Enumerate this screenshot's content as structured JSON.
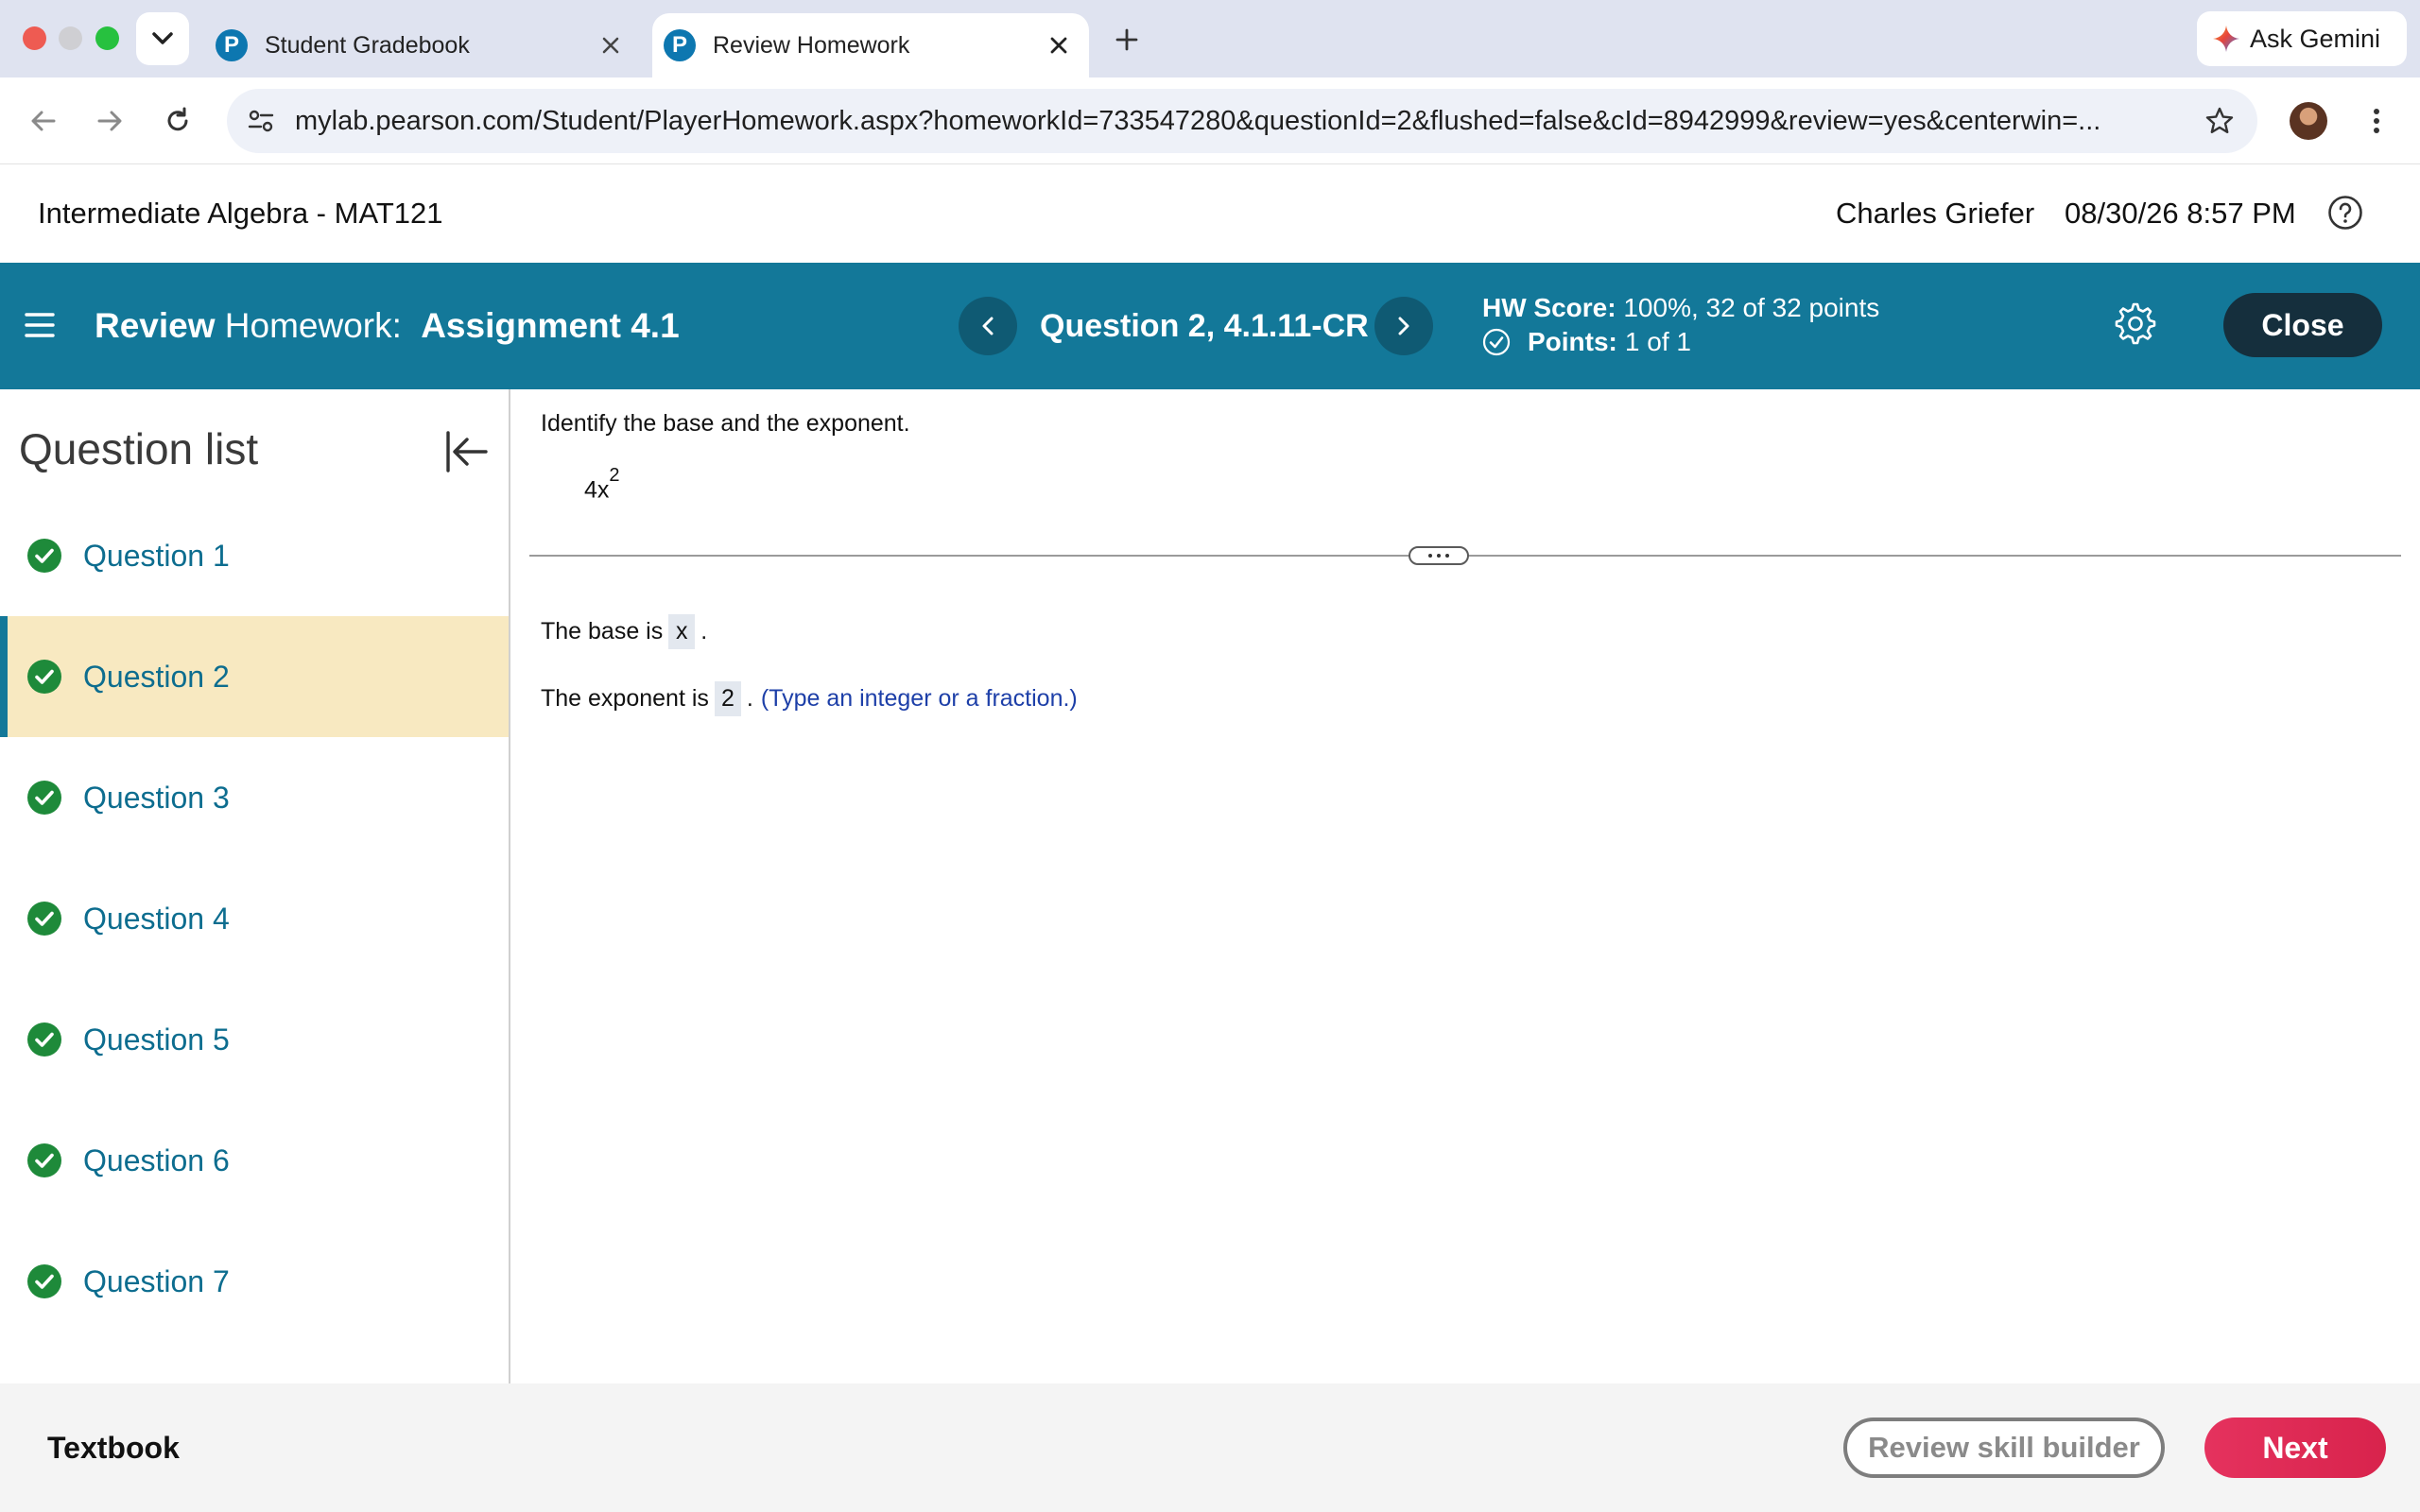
{
  "browser": {
    "tabs": [
      {
        "title": "Student Gradebook",
        "favicon": "P",
        "active": false
      },
      {
        "title": "Review Homework",
        "favicon": "P",
        "active": true
      }
    ],
    "gemini_label": "Ask Gemini",
    "url": "mylab.pearson.com/Student/PlayerHomework.aspx?homeworkId=733547280&questionId=2&flushed=false&cId=8942999&review=yes&centerwin=..."
  },
  "course": {
    "title": "Intermediate Algebra - MAT121",
    "user": "Charles Griefer",
    "datetime": "08/30/26 8:57 PM"
  },
  "assignment": {
    "mode_bold": "Review",
    "mode_rest": "Homework:",
    "name": "Assignment 4.1",
    "question_label": "Question 2, 4.1.11-CR",
    "hw_score_label": "HW Score:",
    "hw_score_value": "100%, 32 of 32 points",
    "points_label": "Points:",
    "points_value": "1 of 1",
    "close_label": "Close",
    "accent_color": "#137899"
  },
  "sidebar": {
    "title": "Question list",
    "items": [
      {
        "label": "Question 1",
        "status": "correct"
      },
      {
        "label": "Question 2",
        "status": "correct",
        "active": true
      },
      {
        "label": "Question 3",
        "status": "correct"
      },
      {
        "label": "Question 4",
        "status": "correct"
      },
      {
        "label": "Question 5",
        "status": "correct"
      },
      {
        "label": "Question 6",
        "status": "correct"
      },
      {
        "label": "Question 7",
        "status": "correct"
      }
    ]
  },
  "question": {
    "prompt": "Identify the base and the exponent.",
    "expression_base": "4x",
    "expression_exponent": "2",
    "base_prefix": "The base is",
    "base_answer": "x",
    "base_suffix": ".",
    "exponent_prefix": "The exponent is",
    "exponent_answer": "2",
    "exponent_suffix": ".",
    "exponent_hint": "(Type an integer or a fraction.)"
  },
  "footer": {
    "textbook_label": "Textbook",
    "skill_builder_label": "Review skill builder",
    "next_label": "Next"
  }
}
